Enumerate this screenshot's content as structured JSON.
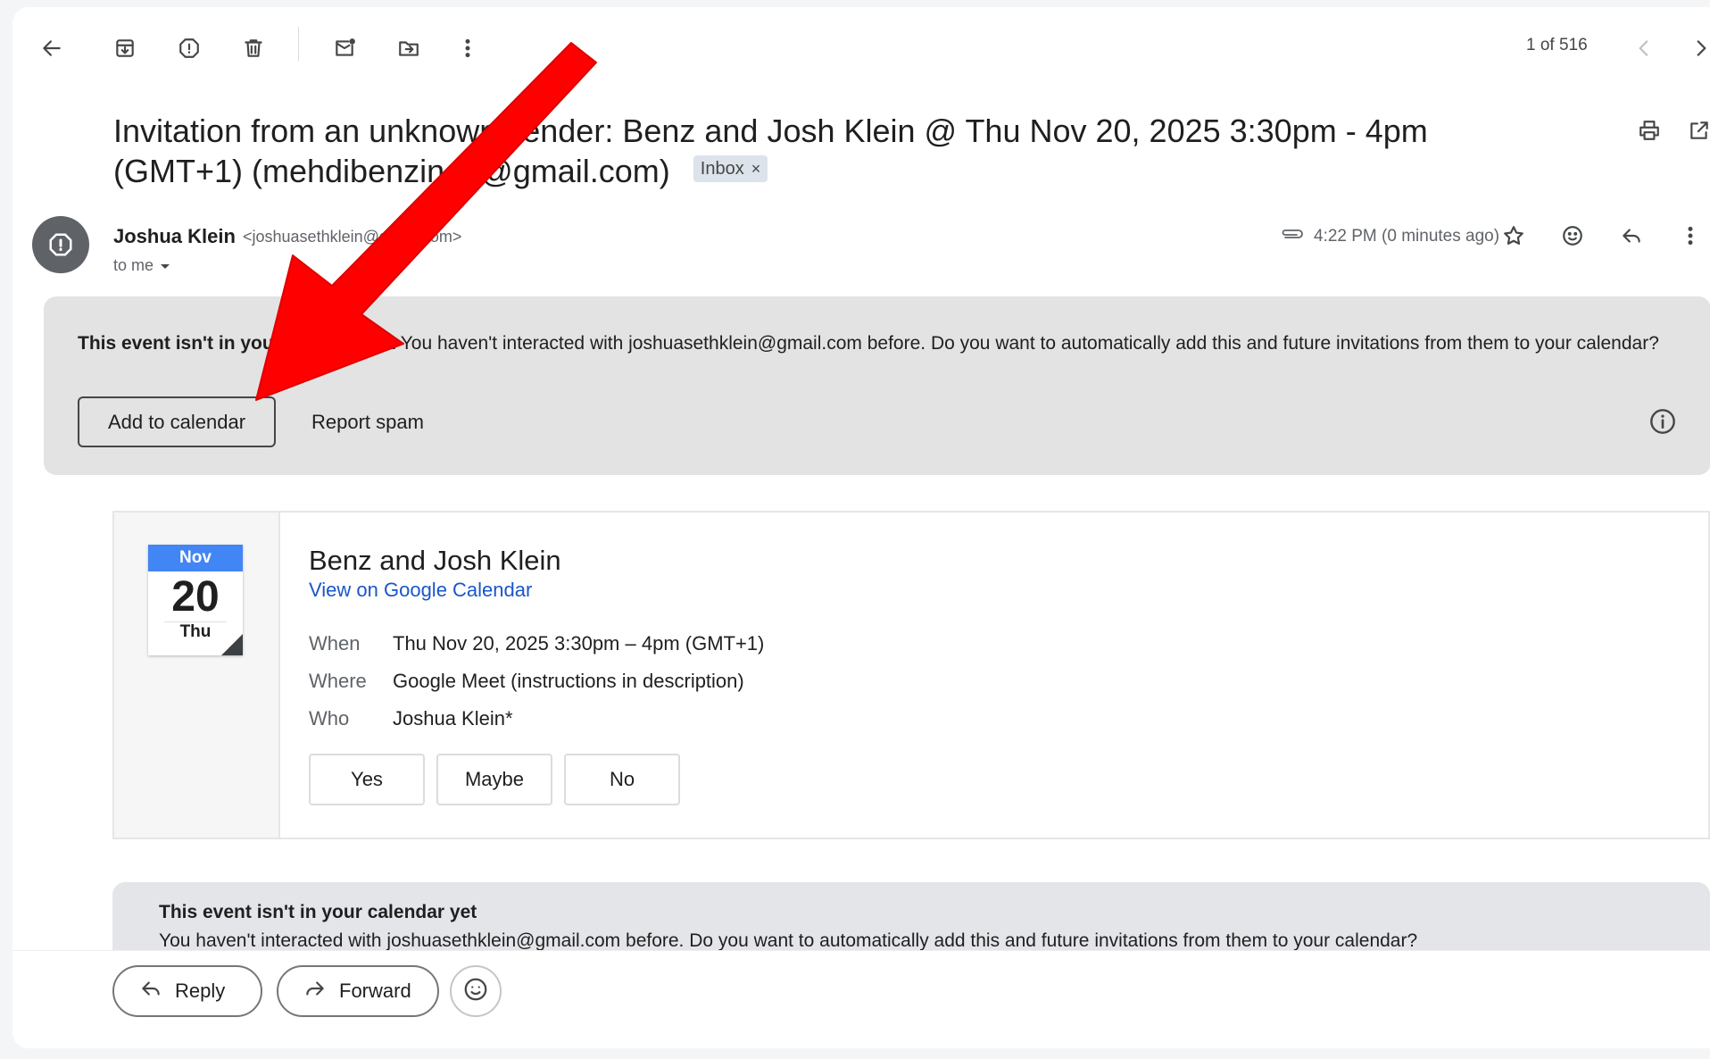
{
  "toolbar": {
    "items": [
      "back-icon",
      "archive-icon",
      "report-spam-icon",
      "delete-icon",
      "mark-unread-icon",
      "move-to-icon",
      "more-vert-icon"
    ],
    "pager_text": "1 of 516"
  },
  "subject": {
    "text": "Invitation from an unknown sender: Benz and Josh Klein @ Thu Nov 20, 2025 3:30pm - 4pm (GMT+1) (mehdibenzine8@gmail.com)",
    "label_chip": "Inbox",
    "chip_close": "×"
  },
  "sender": {
    "name": "Joshua Klein",
    "email": "<joshuasethklein@gmail.com>",
    "to_text": "to me",
    "time": "4:22 PM (0 minutes ago)"
  },
  "banner": {
    "title": "This event isn't in your calendar yet",
    "body": " You haven't interacted with joshuasethklein@gmail.com before. Do you want to automatically add this and future invitations from them to your calendar?",
    "add_button": "Add to calendar",
    "spam_button": "Report spam"
  },
  "invite": {
    "month": "Nov",
    "day": "20",
    "weekday": "Thu",
    "title": "Benz and Josh Klein",
    "link": "View on Google Calendar",
    "rows": [
      {
        "key": "When",
        "value": "Thu Nov 20, 2025 3:30pm – 4pm (GMT+1)"
      },
      {
        "key": "Where",
        "value": "Google Meet (instructions in description)"
      },
      {
        "key": "Who",
        "value": "Joshua Klein*"
      }
    ],
    "rsvp": [
      "Yes",
      "Maybe",
      "No"
    ]
  },
  "banner2": {
    "title": "This event isn't in your calendar yet",
    "body": "You haven't interacted with joshuasethklein@gmail.com before. Do you want to automatically add this and future invitations from them to your calendar?"
  },
  "actions": {
    "reply": "Reply",
    "forward": "Forward"
  },
  "colors": {
    "annotation_arrow": "#ff0000",
    "calendar_month": "#4285f4",
    "link": "#1a56c9",
    "banner_bg": "#e3e3e3"
  }
}
